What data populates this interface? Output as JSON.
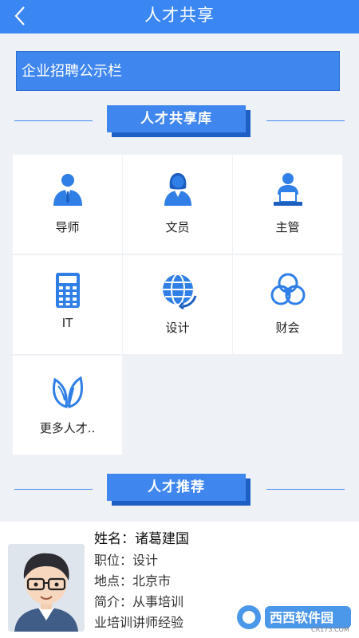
{
  "header": {
    "title": "人才共享"
  },
  "notice_bar": {
    "label": "企业招聘公示栏"
  },
  "talent_library": {
    "heading": "人才共享库",
    "categories": [
      {
        "label": "导师",
        "icon": "mentor-icon"
      },
      {
        "label": "文员",
        "icon": "clerk-icon"
      },
      {
        "label": "主管",
        "icon": "supervisor-icon"
      },
      {
        "label": "IT",
        "icon": "calculator-icon"
      },
      {
        "label": "设计",
        "icon": "globe-icon"
      },
      {
        "label": "财会",
        "icon": "venn-circles-icon"
      },
      {
        "label": "更多人才..",
        "icon": "leaf-icon"
      }
    ]
  },
  "recommend": {
    "heading": "人才推荐",
    "profile": {
      "name": "姓名：诸葛建国",
      "position": "职位：设计",
      "location": "地点：北京市",
      "intro": "简介：从事培训",
      "intro_cont": "业培训讲师经验"
    }
  },
  "watermark": {
    "text": "西西软件园",
    "sub": "CR173.COM"
  },
  "colors": {
    "primary": "#3a86f2",
    "ribbon": "#3f86ee",
    "ribbon_shadow": "#1e5fc6",
    "icon": "#2f7fe6",
    "background": "#eef2f6"
  }
}
